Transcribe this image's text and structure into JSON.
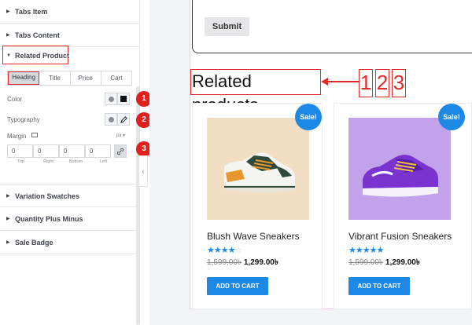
{
  "panel": {
    "sections_top": [
      {
        "label": "Tabs Item"
      },
      {
        "label": "Tabs Content"
      }
    ],
    "related": {
      "label": "Related Product",
      "tabs": [
        {
          "label": "Heading",
          "active": true
        },
        {
          "label": "Title",
          "active": false
        },
        {
          "label": "Price",
          "active": false
        },
        {
          "label": "Cart",
          "active": false
        }
      ],
      "color_label": "Color",
      "typography_label": "Typography",
      "margin_label": "Margin",
      "margin_unit": "px",
      "margin_values": [
        "0",
        "0",
        "0",
        "0"
      ],
      "margin_sides": [
        "Top",
        "Right",
        "Bottom",
        "Left"
      ],
      "swatch_color": "#111111"
    },
    "sections_bottom": [
      {
        "label": "Variation Swatches"
      },
      {
        "label": "Quantity Plus Minus"
      },
      {
        "label": "Sale Badge"
      }
    ],
    "collapse_glyph": "‹"
  },
  "badges": [
    "1",
    "2",
    "3"
  ],
  "accent_red": "#e12b2b",
  "accent_blue": "#1e88e5",
  "preview": {
    "submit_label": "Submit",
    "related_title": "Related products",
    "callout_numbers": [
      "1",
      "2",
      "3"
    ],
    "products": [
      {
        "name": "Blush Wave Sneakers",
        "sale": "Sale!",
        "rating": 4,
        "max_rating": 5,
        "old_price": "1,599.00৳",
        "new_price": "1,299.00৳",
        "cart_label": "ADD TO CART",
        "image_bg": "#f2dfc3",
        "icon": "green-sneaker-image"
      },
      {
        "name": "Vibrant Fusion Sneakers",
        "sale": "Sale!",
        "rating": 5,
        "max_rating": 5,
        "old_price": "1,599.00৳",
        "new_price": "1,299.00৳",
        "cart_label": "ADD TO CART",
        "image_bg": "#c3a2ec",
        "icon": "purple-sneaker-image"
      }
    ]
  }
}
